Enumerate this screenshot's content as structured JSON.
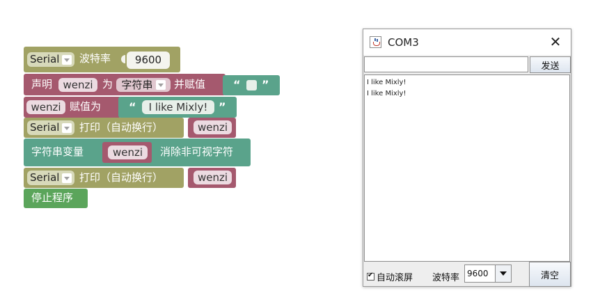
{
  "blocks": {
    "serial_begin": {
      "serial_dd": "Serial",
      "label": "波特率",
      "baud_value": "9600"
    },
    "declare": {
      "label_declare": "声明",
      "var_name": "wenzi",
      "label_as": "为",
      "type_dd": "字符串",
      "label_assign": "并赋值",
      "open_quote": "“",
      "close_quote": "”"
    },
    "assign": {
      "var_name": "wenzi",
      "label": "赋值为",
      "open_quote": "“",
      "string_value": "I like Mixly!",
      "close_quote": "”"
    },
    "print1": {
      "serial_dd": "Serial",
      "label": "打印（自动换行）",
      "var_name": "wenzi"
    },
    "trim": {
      "label_left": "字符串变量",
      "var_name": "wenzi",
      "label_right": "消除非可视字符"
    },
    "print2": {
      "serial_dd": "Serial",
      "label": "打印（自动换行）",
      "var_name": "wenzi"
    },
    "stop": {
      "label": "停止程序"
    }
  },
  "serial_monitor": {
    "title": "COM3",
    "send_input_value": "",
    "send_label": "发送",
    "output_lines": [
      "I like Mixly!",
      "I like Mixly!"
    ],
    "autoscroll_label": "自动滚屏",
    "autoscroll_checked": true,
    "baud_label": "波特率",
    "baud_selected": "9600",
    "clear_label": "清空"
  },
  "colors": {
    "serial_block": "#a1a264",
    "variable_block": "#a5596e",
    "text_block": "#5aa38b",
    "control_block": "#5ba55b"
  },
  "icons": [
    "java-icon",
    "close-icon",
    "chevron-down-icon",
    "checkbox-check-icon"
  ]
}
